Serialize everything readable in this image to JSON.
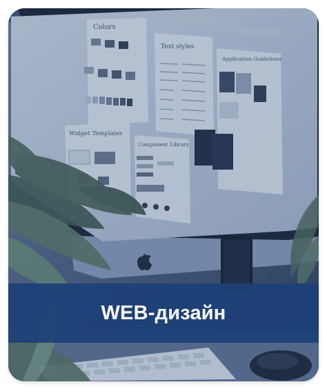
{
  "card": {
    "title": "WEB-дизайн",
    "banner_color": "#1c4078",
    "tint_color": "#2e4a76"
  },
  "photo": {
    "screen_panels": [
      "Colors",
      "Text styles",
      "Application Guidelines",
      "Widget Templates",
      "Component Library"
    ],
    "logo_icon": "apple-logo-icon"
  }
}
